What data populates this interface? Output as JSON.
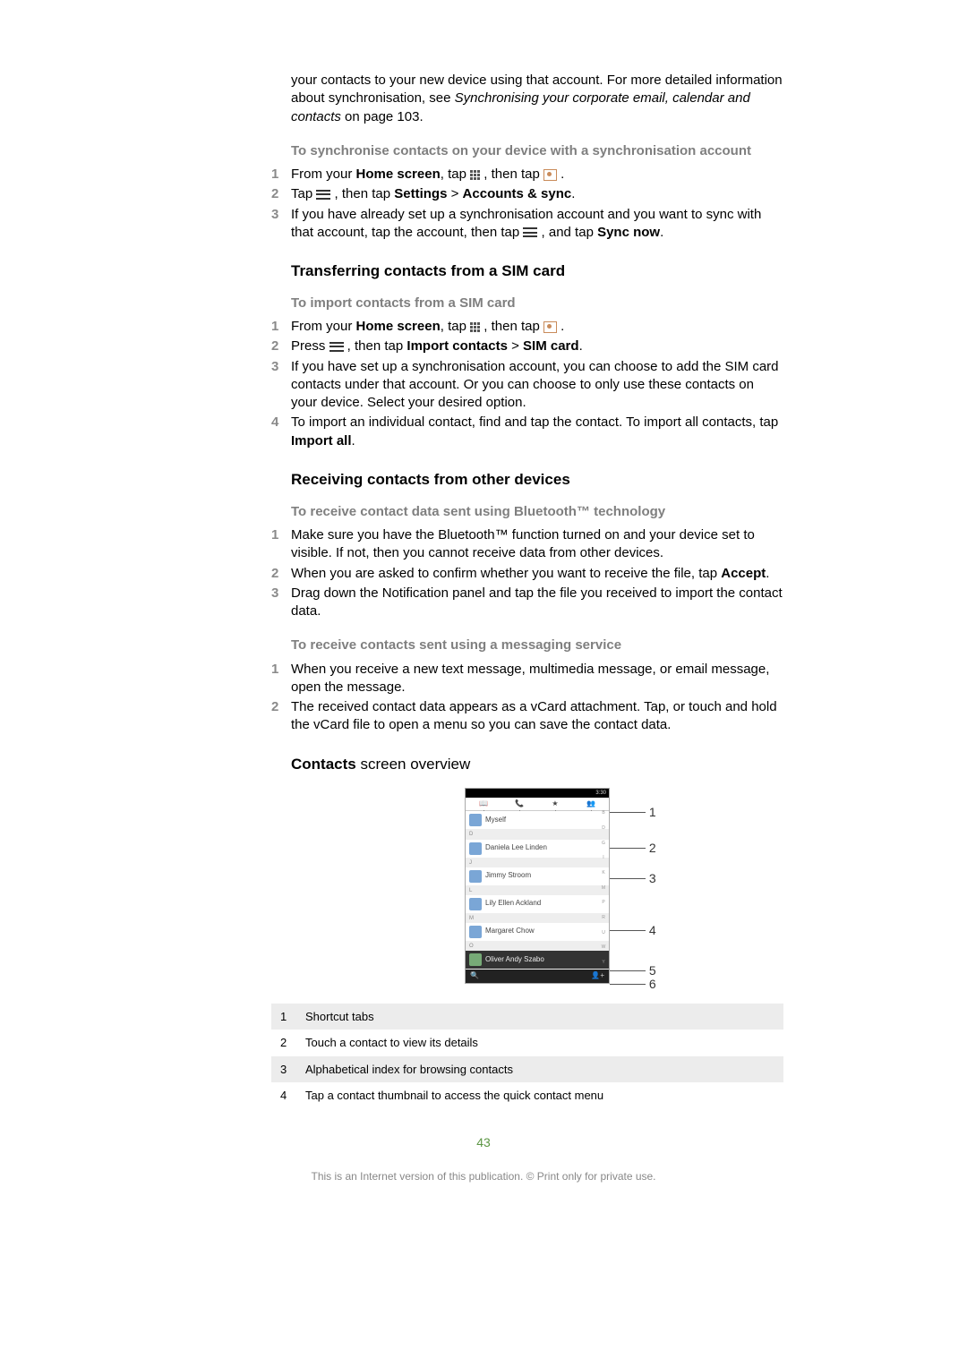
{
  "intro": {
    "line1": "your contacts to your new device using that account. For more detailed information about synchronisation, see ",
    "italic": "Synchronising your corporate email, calendar and contacts",
    "line2": " on page 103."
  },
  "sectionA": {
    "hdr": "To synchronise contacts on your device with a synchronisation account",
    "s1a": "From your ",
    "s1b": "Home screen",
    "s1c": ", tap ",
    "s1d": " , then tap ",
    "s1e": " .",
    "s2a": "Tap ",
    "s2b": " , then tap ",
    "s2c": "Settings",
    "s2d": " > ",
    "s2e": "Accounts & sync",
    "s2f": ".",
    "s3a": "If you have already set up a synchronisation account and you want to sync with that account, tap the account, then tap ",
    "s3b": " , and tap ",
    "s3c": "Sync now",
    "s3d": "."
  },
  "h_transfer": "Transferring contacts from a SIM card",
  "sectionB": {
    "hdr": "To import contacts from a SIM card",
    "s1a": "From your ",
    "s1b": "Home screen",
    "s1c": ", tap ",
    "s1d": " , then tap ",
    "s1e": " .",
    "s2a": "Press ",
    "s2b": " , then tap ",
    "s2c": "Import contacts",
    "s2d": " > ",
    "s2e": "SIM card",
    "s2f": ".",
    "s3": "If you have set up a synchronisation account, you can choose to add the SIM card contacts under that account. Or you can choose to only use these contacts on your device. Select your desired option.",
    "s4a": "To import an individual contact, find and tap the contact. To import all contacts, tap ",
    "s4b": "Import all",
    "s4c": "."
  },
  "h_receive": "Receiving contacts from other devices",
  "sectionC": {
    "hdr": "To receive contact data sent using Bluetooth™ technology",
    "s1": "Make sure you have the Bluetooth™ function turned on and your device set to visible. If not, then you cannot receive data from other devices.",
    "s2a": "When you are asked to confirm whether you want to receive the file, tap ",
    "s2b": "Accept",
    "s2c": ".",
    "s3": "Drag down the Notification panel and tap the file you received to import the contact data."
  },
  "sectionD": {
    "hdr": "To receive contacts sent using a messaging service",
    "s1": "When you receive a new text message, multimedia message, or email message, open the message.",
    "s2": "The received contact data appears as a vCard attachment. Tap, or touch and hold the vCard file to open a menu so you can save the contact data."
  },
  "h_overview_a": "Contacts",
  "h_overview_b": " screen overview",
  "mock": {
    "status": "3:30",
    "rows": [
      "Myself",
      "Daniela Lee Linden",
      "Jimmy Stroom",
      "Lily Ellen Ackland",
      "Margaret Chow",
      "Oliver Andy Szabo"
    ],
    "tab_icons": [
      "📖",
      "📞",
      "★",
      "👥"
    ],
    "bottom_left": "🔍",
    "bottom_right": "👤+"
  },
  "labels": {
    "l1": "1",
    "l2": "2",
    "l3": "3",
    "l4": "4",
    "l5": "5",
    "l6": "6"
  },
  "legend": [
    {
      "n": "1",
      "t": "Shortcut tabs"
    },
    {
      "n": "2",
      "t": "Touch a contact to view its details"
    },
    {
      "n": "3",
      "t": "Alphabetical index for browsing contacts"
    },
    {
      "n": "4",
      "t": "Tap a contact thumbnail to access the quick contact menu"
    }
  ],
  "page_num": "43",
  "footer": "This is an Internet version of this publication. © Print only for private use."
}
